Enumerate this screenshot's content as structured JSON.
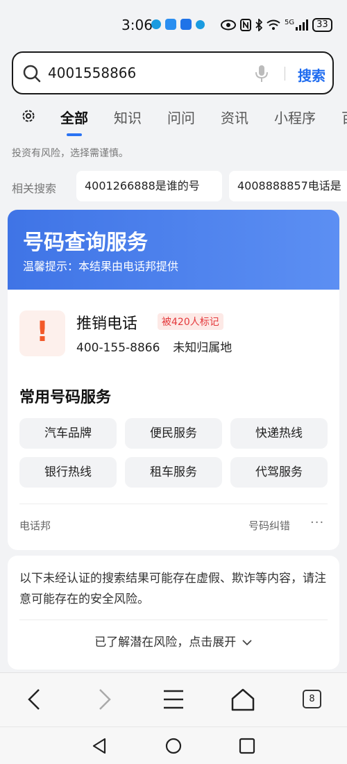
{
  "status_bar": {
    "time": "3:06",
    "network": "5G",
    "battery": "33"
  },
  "search": {
    "query": "4001558866",
    "button_label": "搜索"
  },
  "tabs": [
    {
      "label": "全部",
      "active": true
    },
    {
      "label": "知识",
      "active": false
    },
    {
      "label": "问问",
      "active": false
    },
    {
      "label": "资讯",
      "active": false
    },
    {
      "label": "小程序",
      "active": false
    },
    {
      "label": "百",
      "active": false
    }
  ],
  "disclaimer": "投资有风险，选择需谨慎。",
  "related": {
    "label": "相关搜索",
    "items": [
      "4001266888是谁的号",
      "4008888857电话是"
    ]
  },
  "number_card": {
    "title": "号码查询服务",
    "tip": "温馨提示：本结果由电话邦提供",
    "warning_icon": "exclamation-icon",
    "type_label": "推销电话",
    "mark_badge": "被420人标记",
    "phone": "400-155-8866",
    "location": "未知归属地",
    "services_title": "常用号码服务",
    "services": [
      "汽车品牌",
      "便民服务",
      "快递热线",
      "银行热线",
      "租车服务",
      "代驾服务"
    ],
    "source": "电话邦",
    "correction": "号码纠错",
    "more": "···"
  },
  "risk_notice": {
    "text": "以下未经认证的搜索结果可能存在虚假、欺诈等内容，请注意可能存在的安全风险。",
    "expand_label": "已了解潜在风险，点击展开"
  },
  "browser_nav": {
    "tab_count": "8"
  },
  "colors": {
    "accent": "#1f6cf0",
    "header_gradient_start": "#3f74e6",
    "header_gradient_end": "#5c8ff3",
    "warning": "#f25a2a",
    "badge_text": "#e4393c"
  }
}
